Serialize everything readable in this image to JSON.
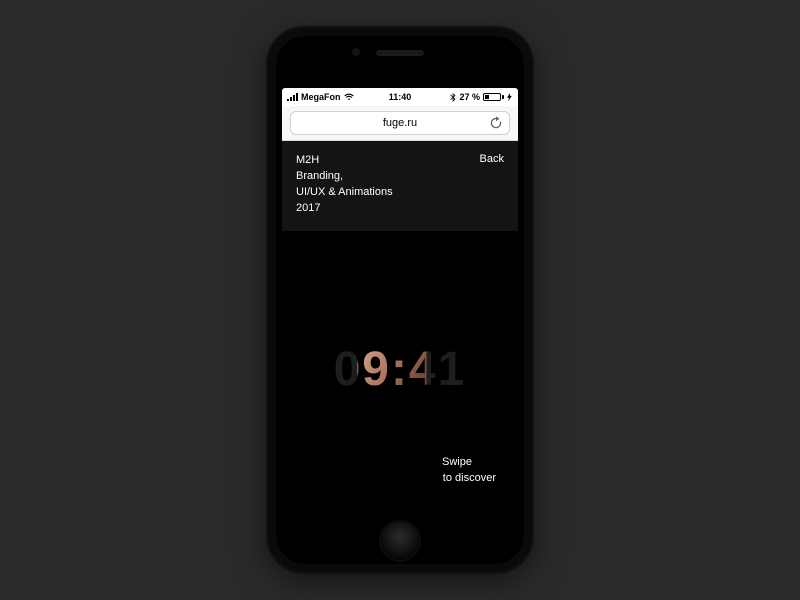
{
  "status": {
    "carrier": "MegaFon",
    "time": "11:40",
    "battery_text": "27 %",
    "battery_pct": 27
  },
  "browser": {
    "url": "fuge.ru"
  },
  "page": {
    "nav_back": "Back",
    "project": {
      "title": "M2H",
      "line2": "Branding,",
      "line3": "UI/UX & Animations",
      "year": "2017"
    },
    "hero_clock": "09:41",
    "swipe_line1": "Swipe",
    "swipe_line2": "to discover"
  }
}
